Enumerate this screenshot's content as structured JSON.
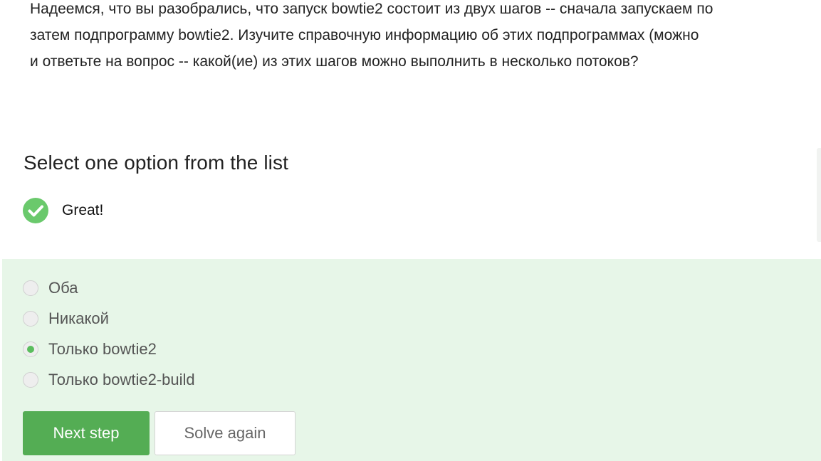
{
  "question": {
    "lines": [
      "Надеемся, что вы разобрались, что запуск bowtie2 состоит из двух шагов -- сначала запускаем по",
      "затем подпрограмму bowtie2. Изучите справочную информацию об этих подпрограммах (можно",
      "и ответьте на вопрос -- какой(ие) из этих шагов можно выполнить в несколько потоков?"
    ]
  },
  "quiz": {
    "heading": "Select one option from the list",
    "feedback": {
      "icon": "check-circle-icon",
      "text": "Great!",
      "color": "#6ac96c"
    },
    "options": [
      {
        "label": "Оба",
        "selected": false
      },
      {
        "label": "Никакой",
        "selected": false
      },
      {
        "label": "Только bowtie2",
        "selected": true
      },
      {
        "label": "Только bowtie2-build",
        "selected": false
      }
    ],
    "buttons": {
      "next_label": "Next step",
      "solve_again_label": "Solve again"
    },
    "colors": {
      "panel_background": "#e7f6e8",
      "accent": "#54ad54"
    }
  }
}
